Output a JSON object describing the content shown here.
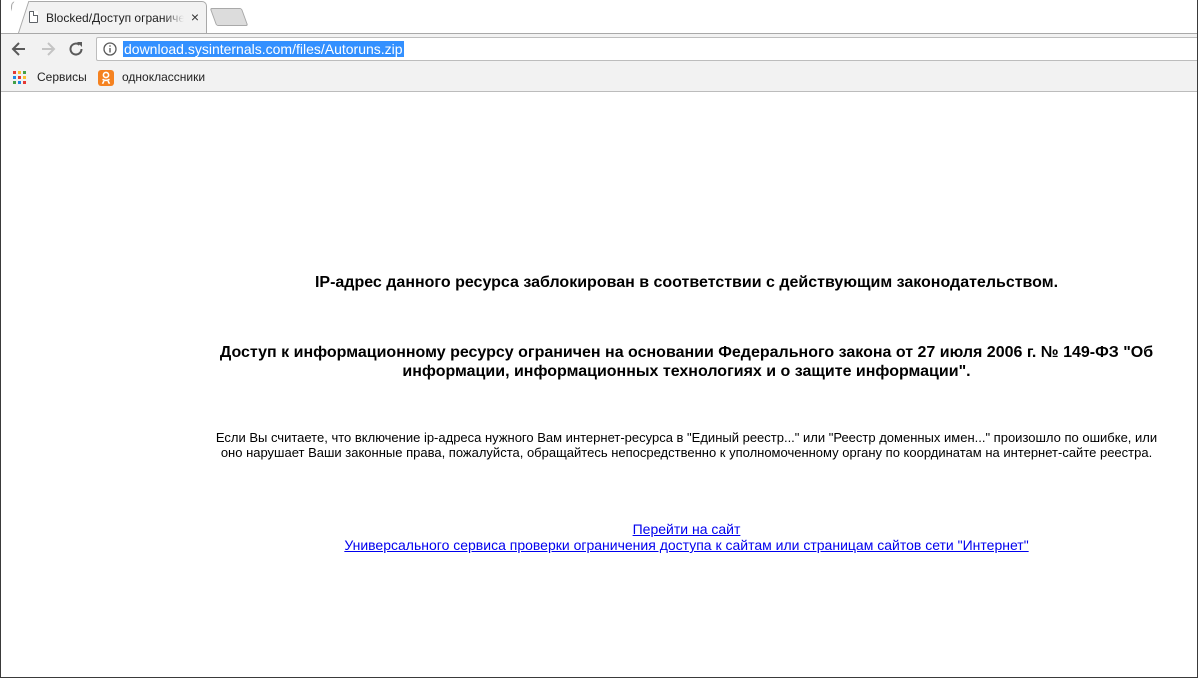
{
  "browser": {
    "tab": {
      "title": "Blocked/Доступ ограничен",
      "close_glyph": "×",
      "favicon": "page-icon"
    },
    "toolbar": {
      "back": "back-arrow-icon",
      "forward": "forward-arrow-icon",
      "reload": "reload-icon",
      "info": "info-icon",
      "url": "download.sysinternals.com/files/Autoruns.zip"
    },
    "bookmarks": [
      {
        "label": "Сервисы",
        "icon": "apps-grid-icon"
      },
      {
        "label": "одноклассники",
        "icon": "odnoklassniki-icon"
      }
    ]
  },
  "page": {
    "heading1": "IP-адрес данного ресурса заблокирован в соответствии с действующим законодательством.",
    "heading2": "Доступ к информационному ресурсу ограничен на основании Федерального закона от 27 июля 2006 г. № 149-ФЗ \"Об информации, информационных технологиях и о защите информации\".",
    "paragraph": "Если Вы считаете, что включение ip-адреса нужного Вам интернет-ресурса в \"Единый реестр...\" или \"Реестр доменных имен...\" произошло по ошибке, или оно нарушает Ваши законные права, пожалуйста, обращайтесь непосредственно к уполномоченному органу по координатам на интернет-сайте реестра.",
    "link1": "Перейти на сайт",
    "link2": "Универсального сервиса проверки ограничения доступа к сайтам или страницам сайтов сети \"Интернет\""
  },
  "colors": {
    "link": "#0000ee",
    "url_highlight": "#3390ff",
    "chrome_bg": "#f2f2f2"
  }
}
